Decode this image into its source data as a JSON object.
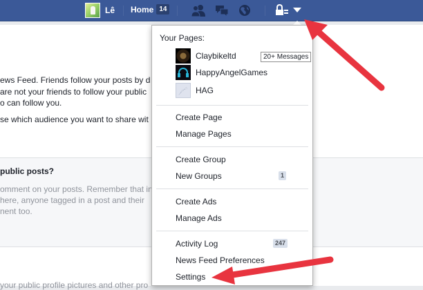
{
  "topbar": {
    "user_name": "Lê",
    "home_label": "Home",
    "home_count": "14",
    "icons": [
      "friends-icon",
      "messages-icon",
      "notifications-globe-icon",
      "privacy-lock-icon",
      "account-menu-caret-icon"
    ],
    "bar_color": "#3b5998"
  },
  "background": {
    "lines": [
      "ews Feed. Friends follow your posts by d",
      "are not your friends to follow your public",
      "o can follow you.",
      "se which audience you want to share wit"
    ],
    "panel_title": "public posts?",
    "panel_lines": [
      "omment on your posts. Remember that in",
      "here, anyone tagged in a post and their",
      "nent too."
    ],
    "bottom_line": "your public profile pictures and other pro"
  },
  "menu": {
    "your_pages_label": "Your Pages:",
    "pages": [
      {
        "name": "Claybikeltd",
        "badge": "20+ Messages"
      },
      {
        "name": "HappyAngelGames"
      },
      {
        "name": "HAG"
      }
    ],
    "items": [
      {
        "label": "Create Page"
      },
      {
        "label": "Manage Pages"
      },
      {
        "label": "Create Group"
      },
      {
        "label": "New Groups",
        "count": "1"
      },
      {
        "label": "Create Ads"
      },
      {
        "label": "Manage Ads"
      },
      {
        "label": "Activity Log",
        "count": "247"
      },
      {
        "label": "News Feed Preferences"
      },
      {
        "label": "Settings"
      }
    ]
  },
  "annotation_color": "#e8343f"
}
